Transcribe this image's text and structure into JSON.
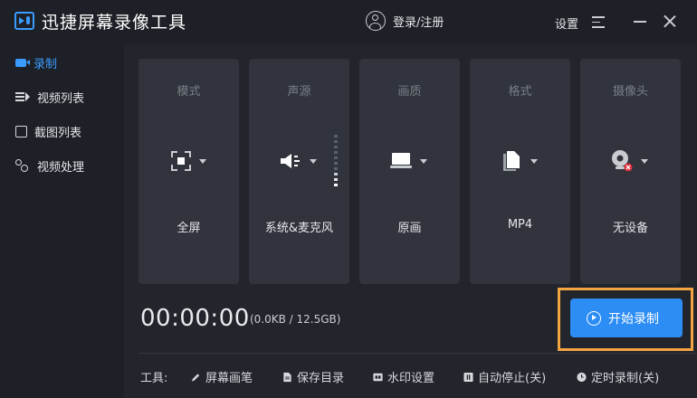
{
  "app": {
    "title": "迅捷屏幕录像工具",
    "login_label": "登录/注册",
    "settings_label": "设置"
  },
  "sidebar": {
    "items": [
      {
        "label": "录制",
        "icon": "record-icon",
        "active": true
      },
      {
        "label": "视频列表",
        "icon": "video-list-icon",
        "active": false
      },
      {
        "label": "截图列表",
        "icon": "screenshot-list-icon",
        "active": false
      },
      {
        "label": "视频处理",
        "icon": "video-process-icon",
        "active": false
      }
    ]
  },
  "cards": [
    {
      "title": "模式",
      "value": "全屏",
      "icon": "fullscreen-icon"
    },
    {
      "title": "声源",
      "value": "系统&麦克风",
      "icon": "speaker-icon"
    },
    {
      "title": "画质",
      "value": "原画",
      "icon": "monitor-icon"
    },
    {
      "title": "格式",
      "value": "MP4",
      "icon": "file-icon"
    },
    {
      "title": "摄像头",
      "value": "无设备",
      "icon": "camera-disabled-icon"
    }
  ],
  "recording": {
    "timer": "00:00:00",
    "size": "(0.0KB / 12.5GB)",
    "start_label": "开始录制"
  },
  "tools": {
    "label": "工具:",
    "items": [
      {
        "label": "屏幕画笔",
        "icon": "pen-icon"
      },
      {
        "label": "保存目录",
        "icon": "folder-doc-icon"
      },
      {
        "label": "水印设置",
        "icon": "watermark-icon"
      },
      {
        "label": "自动停止(关)",
        "icon": "pause-icon"
      },
      {
        "label": "定时录制(关)",
        "icon": "clock-icon"
      }
    ]
  },
  "colors": {
    "accent": "#2c8df5",
    "highlight_frame": "#f5a442",
    "background": "#22252c",
    "card": "#31343c"
  }
}
